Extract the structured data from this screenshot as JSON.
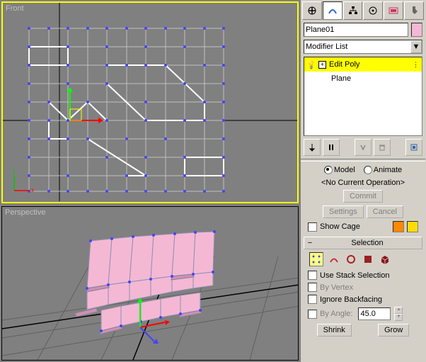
{
  "viewports": {
    "front": {
      "label": "Front"
    },
    "perspective": {
      "label": "Perspective"
    }
  },
  "object_name": "Plane01",
  "modifier_dropdown": "Modifier List",
  "stack": {
    "items": [
      {
        "label": "Edit Poly",
        "selected": true
      },
      {
        "label": "Plane",
        "selected": false
      }
    ]
  },
  "edit_poly_mode": {
    "model_label": "Model",
    "animate_label": "Animate",
    "no_op": "<No Current Operation>",
    "commit": "Commit",
    "settings": "Settings",
    "cancel": "Cancel",
    "show_cage": "Show Cage"
  },
  "selection": {
    "title": "Selection",
    "use_stack": "Use Stack Selection",
    "by_vertex": "By Vertex",
    "ignore_backfacing": "Ignore Backfacing",
    "by_angle": "By Angle:",
    "angle_value": "45.0",
    "shrink": "Shrink",
    "grow": "Grow"
  },
  "colors": {
    "object": "#f4b8d4",
    "cage1": "#ff8800",
    "cage2": "#ffdd00",
    "vertex": "#4444ff",
    "edge_red": "#cc3333",
    "border_red": "#aa2222",
    "poly_red": "#992222",
    "element_red": "#881818"
  }
}
